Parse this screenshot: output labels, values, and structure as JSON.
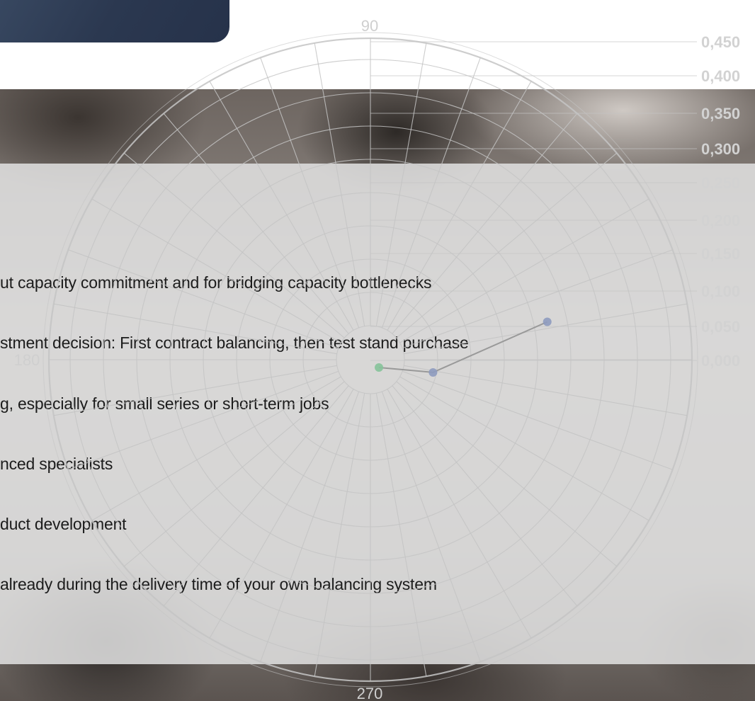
{
  "features": [
    "ut capacity commitment and for bridging capacity bottlenecks",
    "stment decision: First contract balancing, then test stand purchase",
    "g, especially for small series or short-term jobs",
    "nced specialists",
    "duct development",
    "already during the delivery time of your own balancing system"
  ],
  "chart_data": {
    "type": "scatter",
    "coordinate_system": "polar",
    "angle_labels": [
      "90",
      "180",
      "270"
    ],
    "radial_tick_labels": [
      "0,450",
      "0,400",
      "0,350",
      "0,300",
      "0,250",
      "0,200",
      "0,150",
      "0,100",
      "0,050",
      "0,000"
    ],
    "series": [
      {
        "points": [
          {
            "angle": 0,
            "r": 0.003
          }
        ],
        "color": "#86c39a"
      },
      {
        "points": [
          {
            "angle": -5,
            "r": 0.079
          },
          {
            "angle": 15,
            "r": 0.247
          }
        ],
        "color": "#8e9bbf"
      }
    ],
    "line_color": "#999999",
    "grid": true
  },
  "colors": {
    "banner": "#2f3c54",
    "overlay": "#e2e2e2",
    "text": "#1c1c1c",
    "grid": "#c4c4c4"
  }
}
